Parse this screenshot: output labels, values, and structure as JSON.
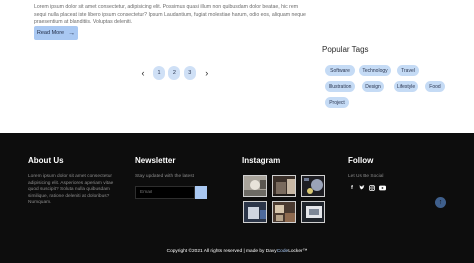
{
  "post": {
    "excerpt": "Lorem ipsum dolor sit amet consectetur, adipisicing elit. Possimus quasi illum non quibusdam dolor beatae, hic rem sequi nulla placeat iste libero ipsum consectetur? Ipsum Laudantium, fugiat molestiae harum, odio eos, aliquam neque praesentium at blanditiis. Voluptas deleniti.",
    "read_more_label": "Read More",
    "read_more_icon": "arrow-right-icon"
  },
  "pagination": {
    "prev_icon": "chevron-left-icon",
    "next_icon": "chevron-right-icon",
    "pages": [
      "1",
      "2",
      "3"
    ]
  },
  "tags": {
    "title": "Popular Tags",
    "items": [
      "Software",
      "Technology",
      "Travel",
      "Illustration",
      "Design",
      "Lifestyle",
      "Food",
      "Project"
    ]
  },
  "footer": {
    "about": {
      "title": "About Us",
      "text": "Lorem ipsum dolor sit amet consectetur adipisicing elit. Asperiores aperiam vitae quod suscipit? Soluta nulla quibusdam similique, ratione deleniti at doloribus? Numquam."
    },
    "newsletter": {
      "title": "Newsletter",
      "subtitle": "Stay updated with the latest",
      "email_placeholder": "Email",
      "submit_icon": "send-icon"
    },
    "instagram": {
      "title": "Instagram",
      "photos": [
        "instagram-photo-1",
        "instagram-photo-2",
        "instagram-photo-3",
        "instagram-photo-4",
        "instagram-photo-5",
        "instagram-photo-6"
      ]
    },
    "follow": {
      "title": "Follow",
      "subtitle": "Let Us Be Social",
      "icons": [
        "facebook-icon",
        "twitter-icon",
        "instagram-icon",
        "youtube-icon"
      ]
    },
    "back_to_top_icon": "arrow-up-icon",
    "copyright_prefix": "Copyright ©2021 All rights reserved | made by Davy",
    "copyright_accent": "Code",
    "copyright_suffix": "Locker™",
    "colors": {
      "background": "#0d0d0d",
      "accent": "#a9c8f2"
    }
  }
}
